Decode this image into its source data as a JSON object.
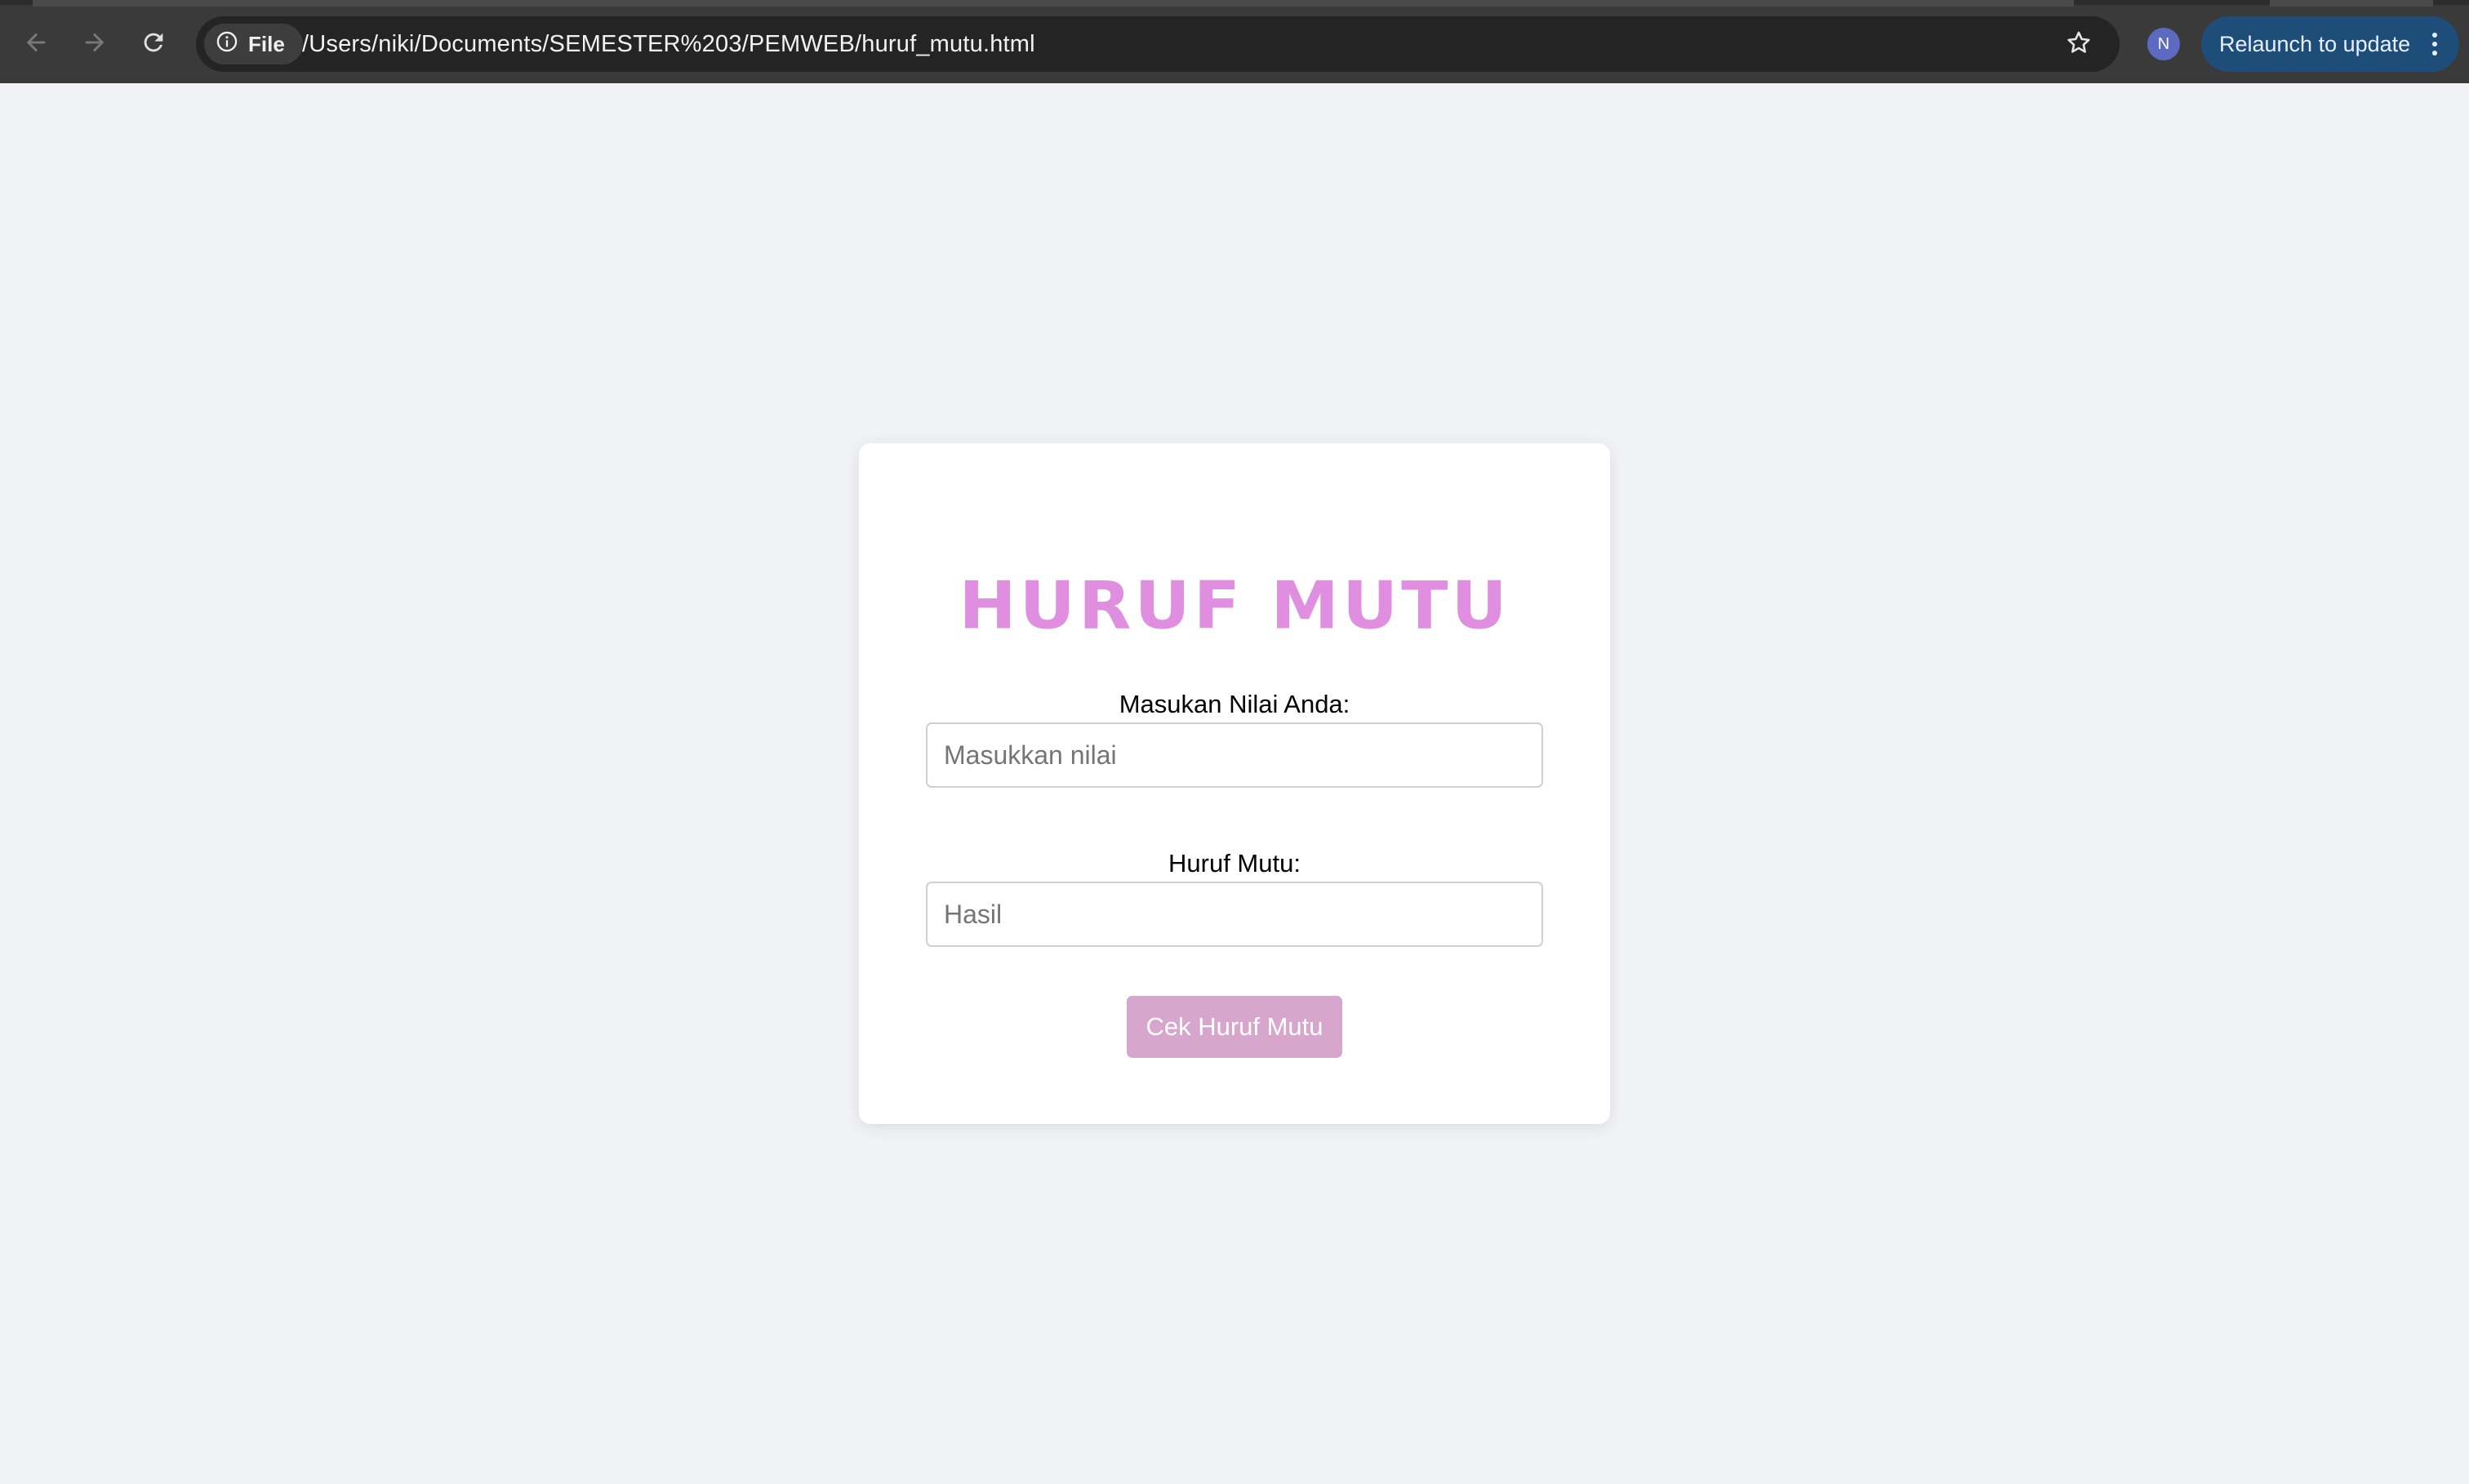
{
  "browser": {
    "site_chip_label": "File",
    "url": "/Users/niki/Documents/SEMESTER%203/PEMWEB/huruf_mutu.html",
    "profile_initial": "N",
    "relaunch_label": "Relaunch to update",
    "icons": {
      "back": "arrow-left-icon",
      "forward": "arrow-right-icon",
      "reload": "reload-icon",
      "site_info": "info-icon",
      "bookmark": "star-icon",
      "menu": "kebab-menu-icon"
    }
  },
  "page": {
    "title": "HURUF MUTU",
    "nilai_label": "Masukan Nilai Anda:",
    "nilai_placeholder": "Masukkan nilai",
    "nilai_value": "",
    "hasil_label": "Huruf Mutu:",
    "hasil_placeholder": "Hasil",
    "hasil_value": "",
    "button_label": "Cek Huruf Mutu"
  },
  "colors": {
    "page_background": "#f0f2f5",
    "title": "#df8ee0",
    "button": "#d7a6cc",
    "chrome": "#3a3a3a",
    "relaunch": "#1f4d7a"
  }
}
